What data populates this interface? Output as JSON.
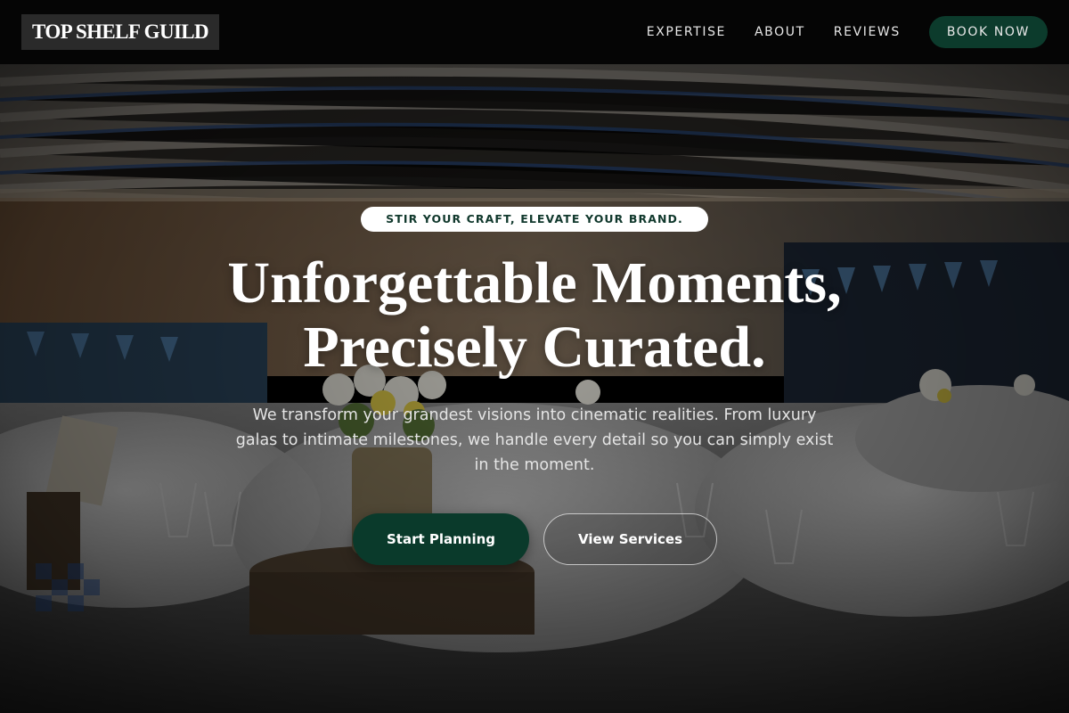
{
  "nav": {
    "logo": "TOP SHELF GUILD",
    "links": [
      "EXPERTISE",
      "ABOUT",
      "REVIEWS"
    ],
    "cta": "BOOK NOW"
  },
  "hero": {
    "tagline": "STIR YOUR CRAFT, ELEVATE YOUR BRAND.",
    "headline_line1": "Unforgettable Moments,",
    "headline_line2": "Precisely Curated.",
    "subheadline": "We transform your grandest visions into cinematic realities. From luxury galas to intimate milestones, we handle every detail so you can simply exist in the moment.",
    "primary_button": "Start Planning",
    "secondary_button": "View Services",
    "background_image": "banquet-hall-photo"
  },
  "colors": {
    "nav_bg": "#050505",
    "logo_bg": "#2a2a2a",
    "brand_green": "#0c3b2c",
    "tagline_text": "#10382c"
  }
}
